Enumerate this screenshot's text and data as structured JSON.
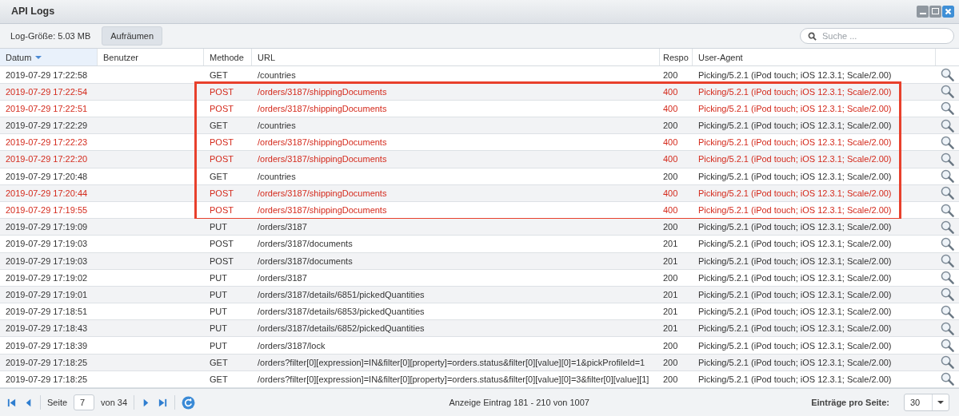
{
  "window": {
    "title": "API Logs"
  },
  "toolbar": {
    "log_size": "Log-Größe: 5.03 MB",
    "clean_button": "Aufräumen",
    "search": {
      "placeholder": "Suche ..."
    }
  },
  "table": {
    "columns": [
      {
        "label": "Datum",
        "sorted": true
      },
      {
        "label": "Benutzer",
        "sorted": false
      },
      {
        "label": "Methode",
        "sorted": false
      },
      {
        "label": "URL",
        "sorted": false
      },
      {
        "label": "Respo",
        "sorted": false
      },
      {
        "label": "User-Agent",
        "sorted": false
      }
    ],
    "rows": [
      {
        "date": "2019-07-29 17:22:58",
        "method": "GET",
        "url": "/countries",
        "response": "200",
        "agent": "Picking/5.2.1 (iPod touch; iOS 12.3.1; Scale/2.00)",
        "error": false,
        "highlighted": false
      },
      {
        "date": "2019-07-29 17:22:54",
        "method": "POST",
        "url": "/orders/3187/shippingDocuments",
        "response": "400",
        "agent": "Picking/5.2.1 (iPod touch; iOS 12.3.1; Scale/2.00)",
        "error": true,
        "highlighted": true
      },
      {
        "date": "2019-07-29 17:22:51",
        "method": "POST",
        "url": "/orders/3187/shippingDocuments",
        "response": "400",
        "agent": "Picking/5.2.1 (iPod touch; iOS 12.3.1; Scale/2.00)",
        "error": true,
        "highlighted": true
      },
      {
        "date": "2019-07-29 17:22:29",
        "method": "GET",
        "url": "/countries",
        "response": "200",
        "agent": "Picking/5.2.1 (iPod touch; iOS 12.3.1; Scale/2.00)",
        "error": false,
        "highlighted": true
      },
      {
        "date": "2019-07-29 17:22:23",
        "method": "POST",
        "url": "/orders/3187/shippingDocuments",
        "response": "400",
        "agent": "Picking/5.2.1 (iPod touch; iOS 12.3.1; Scale/2.00)",
        "error": true,
        "highlighted": true
      },
      {
        "date": "2019-07-29 17:22:20",
        "method": "POST",
        "url": "/orders/3187/shippingDocuments",
        "response": "400",
        "agent": "Picking/5.2.1 (iPod touch; iOS 12.3.1; Scale/2.00)",
        "error": true,
        "highlighted": true
      },
      {
        "date": "2019-07-29 17:20:48",
        "method": "GET",
        "url": "/countries",
        "response": "200",
        "agent": "Picking/5.2.1 (iPod touch; iOS 12.3.1; Scale/2.00)",
        "error": false,
        "highlighted": true
      },
      {
        "date": "2019-07-29 17:20:44",
        "method": "POST",
        "url": "/orders/3187/shippingDocuments",
        "response": "400",
        "agent": "Picking/5.2.1 (iPod touch; iOS 12.3.1; Scale/2.00)",
        "error": true,
        "highlighted": true
      },
      {
        "date": "2019-07-29 17:19:55",
        "method": "POST",
        "url": "/orders/3187/shippingDocuments",
        "response": "400",
        "agent": "Picking/5.2.1 (iPod touch; iOS 12.3.1; Scale/2.00)",
        "error": true,
        "highlighted": true
      },
      {
        "date": "2019-07-29 17:19:09",
        "method": "PUT",
        "url": "/orders/3187",
        "response": "200",
        "agent": "Picking/5.2.1 (iPod touch; iOS 12.3.1; Scale/2.00)",
        "error": false,
        "highlighted": false
      },
      {
        "date": "2019-07-29 17:19:03",
        "method": "POST",
        "url": "/orders/3187/documents",
        "response": "201",
        "agent": "Picking/5.2.1 (iPod touch; iOS 12.3.1; Scale/2.00)",
        "error": false,
        "highlighted": false
      },
      {
        "date": "2019-07-29 17:19:03",
        "method": "POST",
        "url": "/orders/3187/documents",
        "response": "201",
        "agent": "Picking/5.2.1 (iPod touch; iOS 12.3.1; Scale/2.00)",
        "error": false,
        "highlighted": false
      },
      {
        "date": "2019-07-29 17:19:02",
        "method": "PUT",
        "url": "/orders/3187",
        "response": "200",
        "agent": "Picking/5.2.1 (iPod touch; iOS 12.3.1; Scale/2.00)",
        "error": false,
        "highlighted": false
      },
      {
        "date": "2019-07-29 17:19:01",
        "method": "PUT",
        "url": "/orders/3187/details/6851/pickedQuantities",
        "response": "201",
        "agent": "Picking/5.2.1 (iPod touch; iOS 12.3.1; Scale/2.00)",
        "error": false,
        "highlighted": false
      },
      {
        "date": "2019-07-29 17:18:51",
        "method": "PUT",
        "url": "/orders/3187/details/6853/pickedQuantities",
        "response": "201",
        "agent": "Picking/5.2.1 (iPod touch; iOS 12.3.1; Scale/2.00)",
        "error": false,
        "highlighted": false
      },
      {
        "date": "2019-07-29 17:18:43",
        "method": "PUT",
        "url": "/orders/3187/details/6852/pickedQuantities",
        "response": "201",
        "agent": "Picking/5.2.1 (iPod touch; iOS 12.3.1; Scale/2.00)",
        "error": false,
        "highlighted": false
      },
      {
        "date": "2019-07-29 17:18:39",
        "method": "PUT",
        "url": "/orders/3187/lock",
        "response": "200",
        "agent": "Picking/5.2.1 (iPod touch; iOS 12.3.1; Scale/2.00)",
        "error": false,
        "highlighted": false
      },
      {
        "date": "2019-07-29 17:18:25",
        "method": "GET",
        "url": "/orders?filter[0][expression]=IN&filter[0][property]=orders.status&filter[0][value][0]=1&pickProfileId=1",
        "response": "200",
        "agent": "Picking/5.2.1 (iPod touch; iOS 12.3.1; Scale/2.00)",
        "error": false,
        "highlighted": false
      },
      {
        "date": "2019-07-29 17:18:25",
        "method": "GET",
        "url": "/orders?filter[0][expression]=IN&filter[0][property]=orders.status&filter[0][value][0]=3&filter[0][value][1]",
        "response": "200",
        "agent": "Picking/5.2.1 (iPod touch; iOS 12.3.1; Scale/2.00)",
        "error": false,
        "highlighted": false
      }
    ]
  },
  "pager": {
    "page_label": "Seite",
    "page": "7",
    "of_label": "von 34",
    "info": "Anzeige Eintrag 181 - 210 von 1007",
    "per_page_label": "Einträge pro Seite:",
    "per_page": "30"
  }
}
